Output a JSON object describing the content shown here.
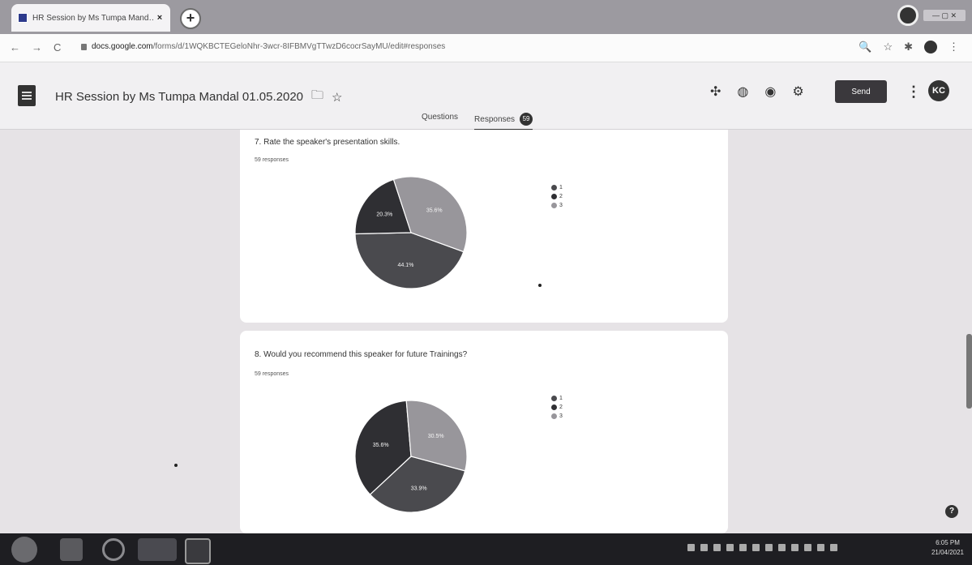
{
  "browser": {
    "tab_title": "HR Session by Ms Tumpa Mand…",
    "tab_close": "×",
    "new_tab": "+",
    "url_host": "docs.google.com",
    "url_path": "/forms/d/1WQKBCTEGeloNhr-3wcr-8IFBMVgTTwzD6cocrSayMU/edit#responses"
  },
  "form": {
    "title": "HR Session by Ms Tumpa Mandal 01.05.2020",
    "send_label": "Send",
    "avatar_initials": "KC",
    "tabs": {
      "questions": "Questions",
      "responses": "Responses",
      "responses_count": "59"
    }
  },
  "questions": [
    {
      "title": "7. Rate the speaker's presentation skills.",
      "responses": "59 responses",
      "legend": [
        "1",
        "2",
        "3"
      ],
      "slice_labels": [
        "35.6%",
        "20.3%",
        "44.1%"
      ]
    },
    {
      "title": "8. Would you recommend this speaker for future Trainings?",
      "responses": "59 responses",
      "legend": [
        "1",
        "2",
        "3"
      ],
      "slice_labels": [
        "30.5%",
        "35.6%",
        "33.9%"
      ]
    }
  ],
  "chart_data": [
    {
      "type": "pie",
      "title": "7. Rate the speaker's presentation skills.",
      "categories": [
        "1",
        "2",
        "3"
      ],
      "values": [
        44.1,
        20.3,
        35.6
      ],
      "colors": [
        "#4a4a4e",
        "#2f2f33",
        "#98969b"
      ]
    },
    {
      "type": "pie",
      "title": "8. Would you recommend this speaker for future Trainings?",
      "categories": [
        "1",
        "2",
        "3"
      ],
      "values": [
        33.9,
        35.6,
        30.5
      ],
      "colors": [
        "#4a4a4e",
        "#2f2f33",
        "#98969b"
      ]
    }
  ],
  "taskbar": {
    "time": "6:05 PM",
    "date": "21/04/2021"
  },
  "help": "?"
}
